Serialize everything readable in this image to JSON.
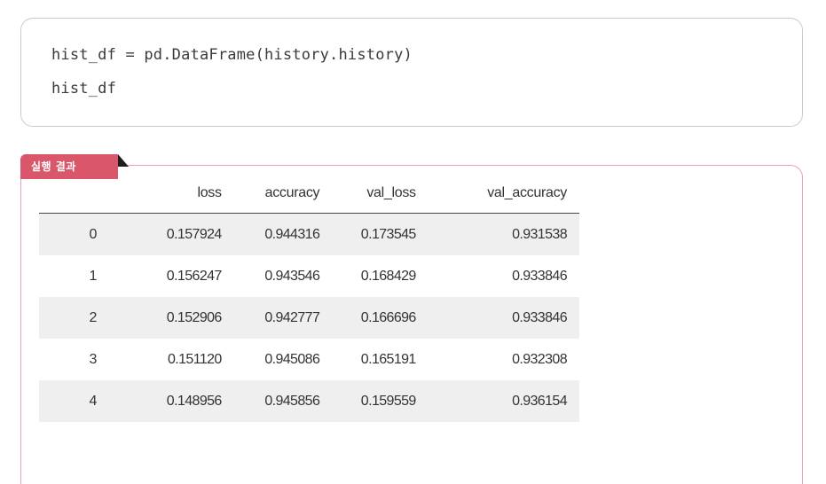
{
  "code": {
    "line1": "hist_df = pd.DataFrame(history.history)",
    "line2": "hist_df"
  },
  "result": {
    "tab_label": "실행 결과",
    "columns": [
      "",
      "loss",
      "accuracy",
      "val_loss",
      "val_accuracy"
    ],
    "rows": [
      {
        "index": "0",
        "loss": "0.157924",
        "accuracy": "0.944316",
        "val_loss": "0.173545",
        "val_accuracy": "0.931538"
      },
      {
        "index": "1",
        "loss": "0.156247",
        "accuracy": "0.943546",
        "val_loss": "0.168429",
        "val_accuracy": "0.933846"
      },
      {
        "index": "2",
        "loss": "0.152906",
        "accuracy": "0.942777",
        "val_loss": "0.166696",
        "val_accuracy": "0.933846"
      },
      {
        "index": "3",
        "loss": "0.151120",
        "accuracy": "0.945086",
        "val_loss": "0.165191",
        "val_accuracy": "0.932308"
      },
      {
        "index": "4",
        "loss": "0.148956",
        "accuracy": "0.945856",
        "val_loss": "0.159559",
        "val_accuracy": "0.936154"
      }
    ]
  },
  "colors": {
    "accent": "#d9566b",
    "result_border": "#e8a2ad",
    "code_border": "#c9c9d6",
    "row_shade": "#efefef"
  }
}
